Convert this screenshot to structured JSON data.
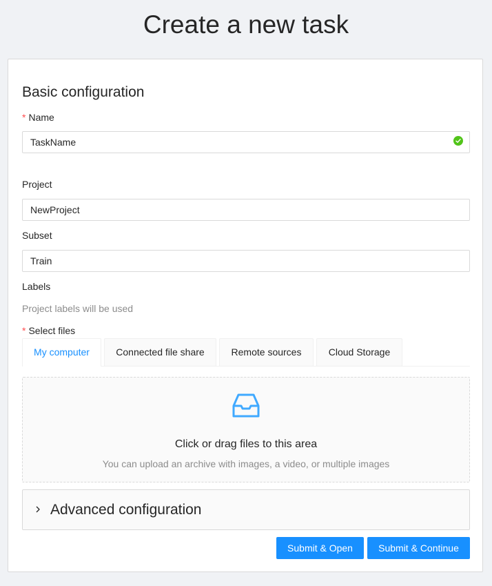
{
  "page": {
    "title": "Create a new task"
  },
  "basic": {
    "title": "Basic configuration",
    "name": {
      "required_mark": "*",
      "label": "Name",
      "value": "TaskName",
      "status_icon": "check-circle-icon"
    },
    "project": {
      "label": "Project",
      "value": "NewProject"
    },
    "subset": {
      "label": "Subset",
      "value": "Train"
    },
    "labels": {
      "label": "Labels",
      "hint": "Project labels will be used"
    },
    "select_files": {
      "required_mark": "*",
      "label": "Select files"
    }
  },
  "tabs": [
    {
      "label": "My computer",
      "active": true
    },
    {
      "label": "Connected file share",
      "active": false
    },
    {
      "label": "Remote sources",
      "active": false
    },
    {
      "label": "Cloud Storage",
      "active": false
    }
  ],
  "dropzone": {
    "icon": "inbox-icon",
    "text": "Click or drag files to this area",
    "hint": "You can upload an archive with images, a video, or multiple images"
  },
  "advanced": {
    "title": "Advanced configuration",
    "icon": "chevron-right-icon"
  },
  "buttons": {
    "submit_open": "Submit & Open",
    "submit_continue": "Submit & Continue"
  },
  "colors": {
    "primary": "#1890ff",
    "success": "#52c41a",
    "required": "#ff4d4f"
  }
}
